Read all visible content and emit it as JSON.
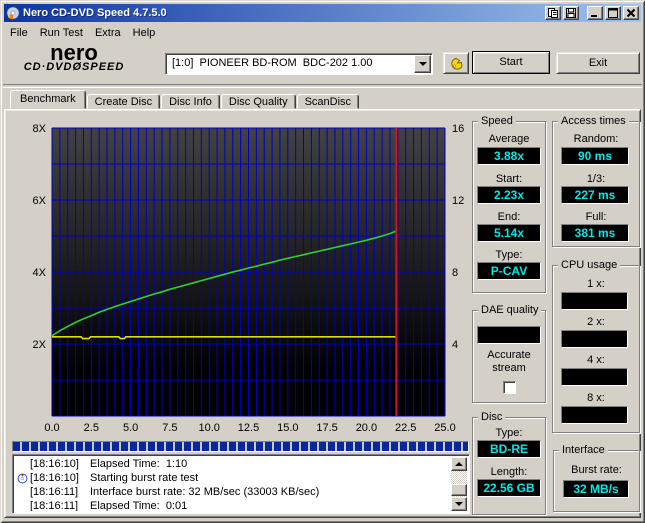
{
  "window": {
    "title": "Nero CD-DVD Speed 4.7.5.0"
  },
  "menu": {
    "items": [
      "File",
      "Run Test",
      "Extra",
      "Help"
    ]
  },
  "toolbar": {
    "logo_line1": "nero",
    "logo_line2": "CD·DVDØSPEED",
    "drive_selected": "[1:0]  PIONEER BD-ROM  BDC-202 1.00",
    "start_label": "Start",
    "exit_label": "Exit"
  },
  "tabs": [
    {
      "label": "Benchmark",
      "active": true
    },
    {
      "label": "Create Disc",
      "active": false
    },
    {
      "label": "Disc Info",
      "active": false
    },
    {
      "label": "Disc Quality",
      "active": false
    },
    {
      "label": "ScanDisc",
      "active": false
    }
  ],
  "chart_data": {
    "type": "line",
    "title": "",
    "xlabel": "",
    "ylabel": "",
    "x_axis": {
      "min": 0,
      "max": 25,
      "tick_step": 2.5,
      "minor_grid_step": 0.5,
      "tick_labels": [
        "0.0",
        "2.5",
        "5.0",
        "7.5",
        "10.0",
        "12.5",
        "15.0",
        "17.5",
        "20.0",
        "22.5",
        "25.0"
      ]
    },
    "y_axis_left": {
      "min": 0,
      "max": 8,
      "grid_step": 1,
      "ticks": [
        {
          "value": 8,
          "label": "8X"
        },
        {
          "value": 6,
          "label": "6X"
        },
        {
          "value": 4,
          "label": "4X"
        },
        {
          "value": 2,
          "label": "2X"
        }
      ]
    },
    "y_axis_right": {
      "min": 0,
      "max": 16,
      "ticks": [
        {
          "value": 16,
          "label": "16"
        },
        {
          "value": 12,
          "label": "12"
        },
        {
          "value": 8,
          "label": "8"
        },
        {
          "value": 4,
          "label": "4"
        }
      ]
    },
    "grid": true,
    "legend": false,
    "series": [
      {
        "name": "read-speed-curve",
        "color": "#30d030",
        "points": [
          [
            0,
            2.23
          ],
          [
            0.5,
            2.37
          ],
          [
            1,
            2.49
          ],
          [
            1.5,
            2.6
          ],
          [
            2,
            2.7
          ],
          [
            2.5,
            2.79
          ],
          [
            3,
            2.88
          ],
          [
            3.5,
            2.96
          ],
          [
            4,
            3.04
          ],
          [
            4.5,
            3.11
          ],
          [
            5,
            3.18
          ],
          [
            5.5,
            3.25
          ],
          [
            6,
            3.32
          ],
          [
            6.5,
            3.39
          ],
          [
            7,
            3.45
          ],
          [
            7.5,
            3.52
          ],
          [
            8,
            3.58
          ],
          [
            8.5,
            3.64
          ],
          [
            9,
            3.7
          ],
          [
            9.5,
            3.76
          ],
          [
            10,
            3.82
          ],
          [
            10.5,
            3.88
          ],
          [
            11,
            3.94
          ],
          [
            11.5,
            4.0
          ],
          [
            12,
            4.05
          ],
          [
            12.5,
            4.11
          ],
          [
            13,
            4.16
          ],
          [
            13.5,
            4.22
          ],
          [
            14,
            4.27
          ],
          [
            14.5,
            4.33
          ],
          [
            15,
            4.38
          ],
          [
            15.5,
            4.43
          ],
          [
            16,
            4.48
          ],
          [
            16.5,
            4.53
          ],
          [
            17,
            4.58
          ],
          [
            17.5,
            4.63
          ],
          [
            18,
            4.68
          ],
          [
            18.5,
            4.73
          ],
          [
            19,
            4.78
          ],
          [
            19.5,
            4.83
          ],
          [
            20,
            4.88
          ],
          [
            20.5,
            4.94
          ],
          [
            21,
            5.0
          ],
          [
            21.5,
            5.07
          ],
          [
            21.9,
            5.14
          ]
        ]
      },
      {
        "name": "rotation-speed-line",
        "color": "#e0e000",
        "points": [
          [
            0,
            2.2
          ],
          [
            1.85,
            2.2
          ],
          [
            1.95,
            2.15
          ],
          [
            2.35,
            2.15
          ],
          [
            2.45,
            2.2
          ],
          [
            4.25,
            2.2
          ],
          [
            4.35,
            2.15
          ],
          [
            4.6,
            2.15
          ],
          [
            4.7,
            2.2
          ],
          [
            21.9,
            2.2
          ]
        ]
      }
    ],
    "markers": [
      {
        "type": "vline",
        "x": 21.9,
        "color": "#d81414"
      }
    ],
    "style": {
      "grid_color": "#0000c8",
      "bg_top": "#424242",
      "bg_bottom": "#000000"
    }
  },
  "panels": {
    "speed": {
      "title": "Speed",
      "fields": [
        {
          "label": "Average",
          "value": "3.88x"
        },
        {
          "label": "Start:",
          "value": "2.23x"
        },
        {
          "label": "End:",
          "value": "5.14x"
        },
        {
          "label": "Type:",
          "value": "P-CAV"
        }
      ]
    },
    "access_times": {
      "title": "Access times",
      "fields": [
        {
          "label": "Random:",
          "value": "90 ms"
        },
        {
          "label": "1/3:",
          "value": "227 ms"
        },
        {
          "label": "Full:",
          "value": "381 ms"
        }
      ]
    },
    "dae_quality": {
      "title": "DAE quality",
      "value": "",
      "checkbox_label": "Accurate stream",
      "checkbox_checked": false
    },
    "cpu_usage": {
      "title": "CPU usage",
      "fields": [
        {
          "label": "1 x:",
          "value": ""
        },
        {
          "label": "2 x:",
          "value": ""
        },
        {
          "label": "4 x:",
          "value": ""
        },
        {
          "label": "8 x:",
          "value": ""
        }
      ]
    },
    "disc": {
      "title": "Disc",
      "fields": [
        {
          "label": "Type:",
          "value": "BD-RE"
        },
        {
          "label": "Length:",
          "value": "22.56 GB"
        }
      ]
    },
    "interface": {
      "title": "Interface",
      "fields": [
        {
          "label": "Burst rate:",
          "value": "32 MB/s"
        }
      ]
    }
  },
  "log": {
    "lines": [
      {
        "time": "[18:16:10]",
        "text": "Elapsed Time:  1:10",
        "icon": false
      },
      {
        "time": "[18:16:10]",
        "text": "Starting burst rate test",
        "icon": true
      },
      {
        "time": "[18:16:11]",
        "text": "Interface burst rate: 32 MB/sec (33003 KB/sec)",
        "icon": false
      },
      {
        "time": "[18:16:11]",
        "text": "Elapsed Time:  0:01",
        "icon": false
      }
    ]
  }
}
